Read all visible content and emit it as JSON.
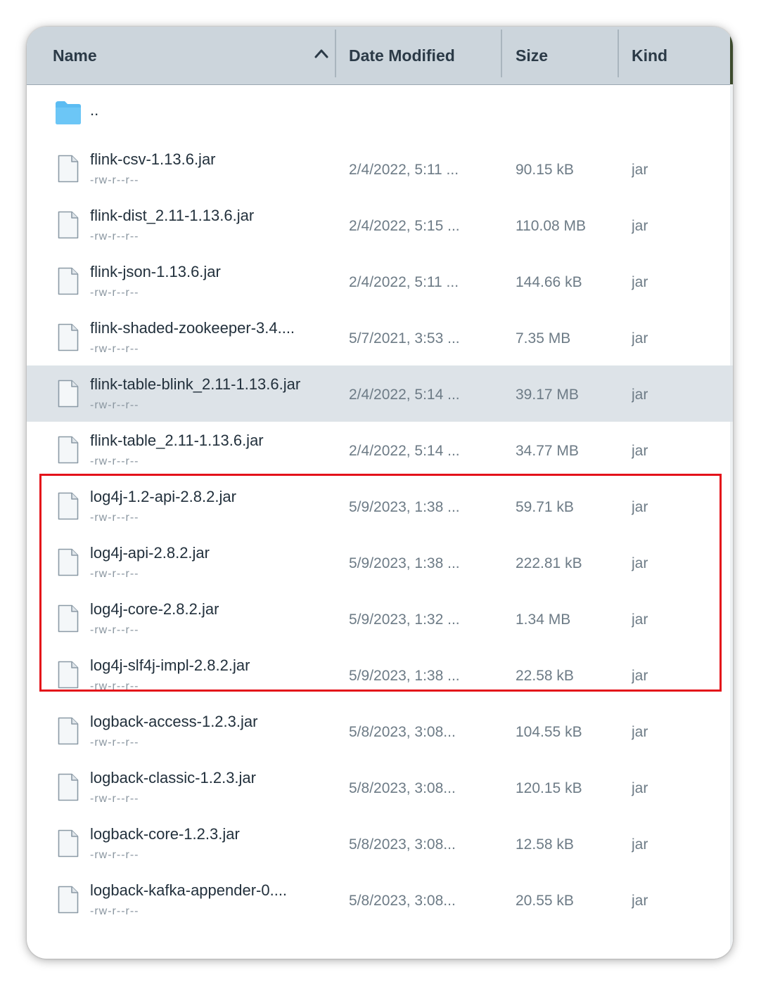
{
  "header": {
    "name": "Name",
    "date_modified": "Date Modified",
    "size": "Size",
    "kind": "Kind"
  },
  "parent": {
    "label": ".."
  },
  "files": [
    {
      "name": "flink-csv-1.13.6.jar",
      "perm": "-rw-r--r--",
      "date": "2/4/2022, 5:11 ...",
      "size": "90.15 kB",
      "kind": "jar"
    },
    {
      "name": "flink-dist_2.11-1.13.6.jar",
      "perm": "-rw-r--r--",
      "date": "2/4/2022, 5:15 ...",
      "size": "110.08 MB",
      "kind": "jar"
    },
    {
      "name": "flink-json-1.13.6.jar",
      "perm": "-rw-r--r--",
      "date": "2/4/2022, 5:11 ...",
      "size": "144.66 kB",
      "kind": "jar"
    },
    {
      "name": "flink-shaded-zookeeper-3.4....",
      "perm": "-rw-r--r--",
      "date": "5/7/2021, 3:53 ...",
      "size": "7.35 MB",
      "kind": "jar"
    },
    {
      "name": "flink-table-blink_2.11-1.13.6.jar",
      "perm": "-rw-r--r--",
      "date": "2/4/2022, 5:14 ...",
      "size": "39.17 MB",
      "kind": "jar"
    },
    {
      "name": "flink-table_2.11-1.13.6.jar",
      "perm": "-rw-r--r--",
      "date": "2/4/2022, 5:14 ...",
      "size": "34.77 MB",
      "kind": "jar"
    },
    {
      "name": "log4j-1.2-api-2.8.2.jar",
      "perm": "-rw-r--r--",
      "date": "5/9/2023, 1:38 ...",
      "size": "59.71 kB",
      "kind": "jar"
    },
    {
      "name": "log4j-api-2.8.2.jar",
      "perm": "-rw-r--r--",
      "date": "5/9/2023, 1:38 ...",
      "size": "222.81 kB",
      "kind": "jar"
    },
    {
      "name": "log4j-core-2.8.2.jar",
      "perm": "-rw-r--r--",
      "date": "5/9/2023, 1:32 ...",
      "size": "1.34 MB",
      "kind": "jar"
    },
    {
      "name": "log4j-slf4j-impl-2.8.2.jar",
      "perm": "-rw-r--r--",
      "date": "5/9/2023, 1:38 ...",
      "size": "22.58 kB",
      "kind": "jar"
    },
    {
      "name": "logback-access-1.2.3.jar",
      "perm": "-rw-r--r--",
      "date": "5/8/2023, 3:08...",
      "size": "104.55 kB",
      "kind": "jar"
    },
    {
      "name": "logback-classic-1.2.3.jar",
      "perm": "-rw-r--r--",
      "date": "5/8/2023, 3:08...",
      "size": "120.15 kB",
      "kind": "jar"
    },
    {
      "name": "logback-core-1.2.3.jar",
      "perm": "-rw-r--r--",
      "date": "5/8/2023, 3:08...",
      "size": "12.58 kB",
      "kind": "jar"
    },
    {
      "name": "logback-kafka-appender-0....",
      "perm": "-rw-r--r--",
      "date": "5/8/2023, 3:08...",
      "size": "20.55 kB",
      "kind": "jar"
    }
  ],
  "selected_index": 4,
  "colors": {
    "header_bg": "#ccd5dc",
    "selected_row_bg": "#dde3e8",
    "highlight_border": "#e4121a",
    "folder_blue": "#5bbcf2"
  }
}
